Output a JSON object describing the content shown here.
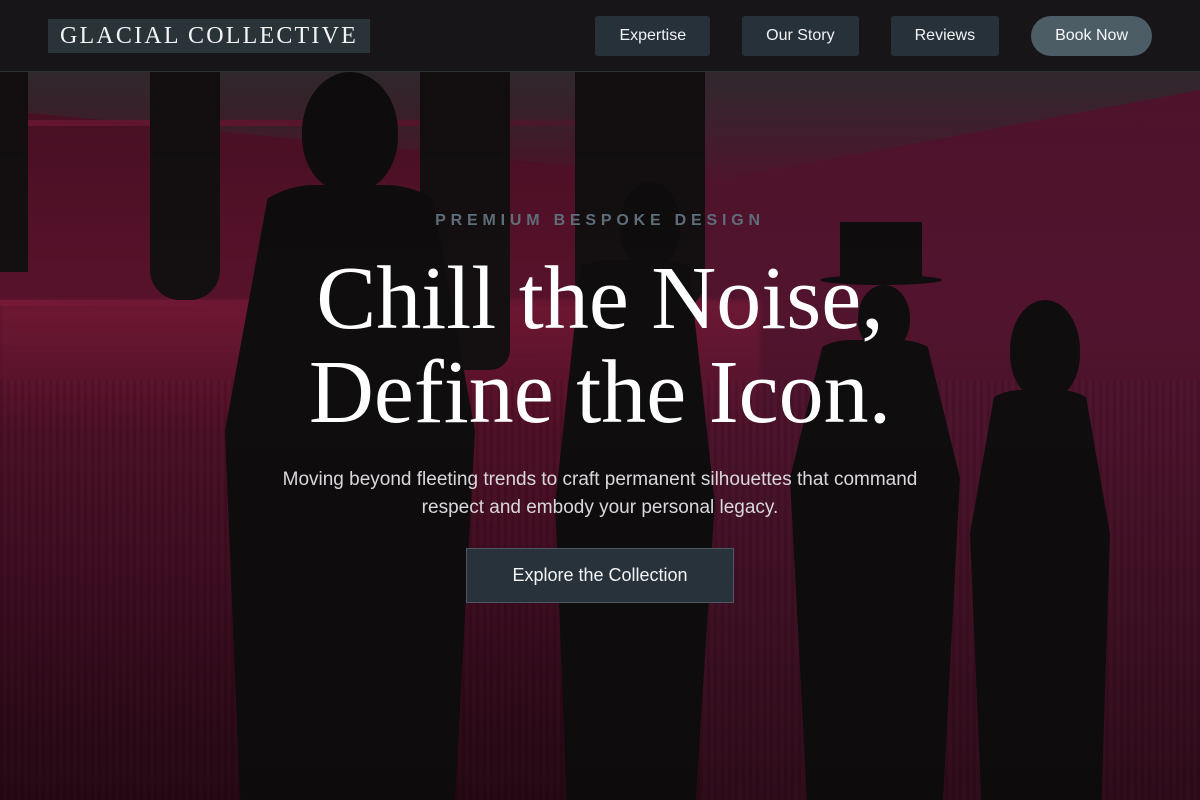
{
  "brand": {
    "name": "GLACIAL COLLECTIVE"
  },
  "nav": {
    "links": [
      {
        "label": "Expertise"
      },
      {
        "label": "Our Story"
      },
      {
        "label": "Reviews"
      }
    ],
    "cta_label": "Book Now"
  },
  "hero": {
    "eyebrow": "PREMIUM BESPOKE DESIGN",
    "headline_line1": "Chill the Noise,",
    "headline_line2": "Define the Icon.",
    "subtext": "Moving beyond fleeting trends to craft permanent silhouettes that command respect and embody your personal legacy.",
    "cta_label": "Explore the Collection"
  },
  "colors": {
    "nav_background": "#141618",
    "nav_button": "#27313a",
    "nav_cta": "#4c5d66",
    "hero_wall": "#7a1a3c",
    "eyebrow": "#5e6d78",
    "cta_background": "#27323a"
  }
}
